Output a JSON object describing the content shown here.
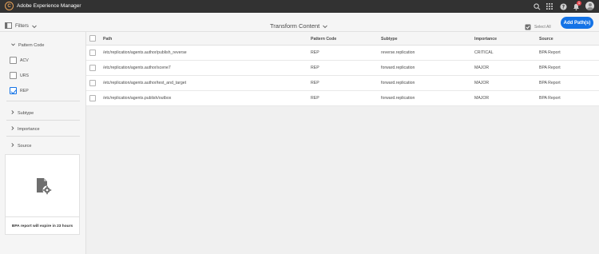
{
  "app": {
    "title": "Adobe Experience Manager",
    "logo_glyph": "C"
  },
  "topbar": {
    "icons": [
      "search-icon",
      "apps-grid-icon",
      "help-icon",
      "bell-icon",
      "user-avatar"
    ],
    "notification_count": "1"
  },
  "actionbar": {
    "filters_label": "Filters",
    "page_title": "Transform Content",
    "select_all_label": "Select All",
    "add_button_label": "Add Path(s)"
  },
  "sidebar": {
    "pattern_code": {
      "title": "Pattern Code",
      "options": [
        {
          "label": "ACV",
          "checked": false
        },
        {
          "label": "URS",
          "checked": false
        },
        {
          "label": "REP",
          "checked": true
        }
      ]
    },
    "subtype": {
      "title": "Subtype"
    },
    "importance": {
      "title": "Importance"
    },
    "source": {
      "title": "Source"
    },
    "expire_notice": "BPA report will expire in 23 hours"
  },
  "table": {
    "columns": [
      "Path",
      "Pattern Code",
      "Subtype",
      "Importance",
      "Source"
    ],
    "rows": [
      {
        "path": "/etc/replication/agents.author/publish_reverse",
        "pattern": "REP",
        "subtype": "reverse.replication",
        "importance": "CRITICAL",
        "source": "BPA Report"
      },
      {
        "path": "/etc/replication/agents.author/scene7",
        "pattern": "REP",
        "subtype": "forward.replication",
        "importance": "MAJOR",
        "source": "BPA Report"
      },
      {
        "path": "/etc/replication/agents.author/test_and_target",
        "pattern": "REP",
        "subtype": "forward.replication",
        "importance": "MAJOR",
        "source": "BPA Report"
      },
      {
        "path": "/etc/replication/agents.publish/outbox",
        "pattern": "REP",
        "subtype": "forward.replication",
        "importance": "MAJOR",
        "source": "BPA Report"
      }
    ]
  },
  "colors": {
    "topbar": "#323232",
    "accent": "#1473e6",
    "brand_ring": "#e8a35a",
    "badge": "#e34850"
  }
}
